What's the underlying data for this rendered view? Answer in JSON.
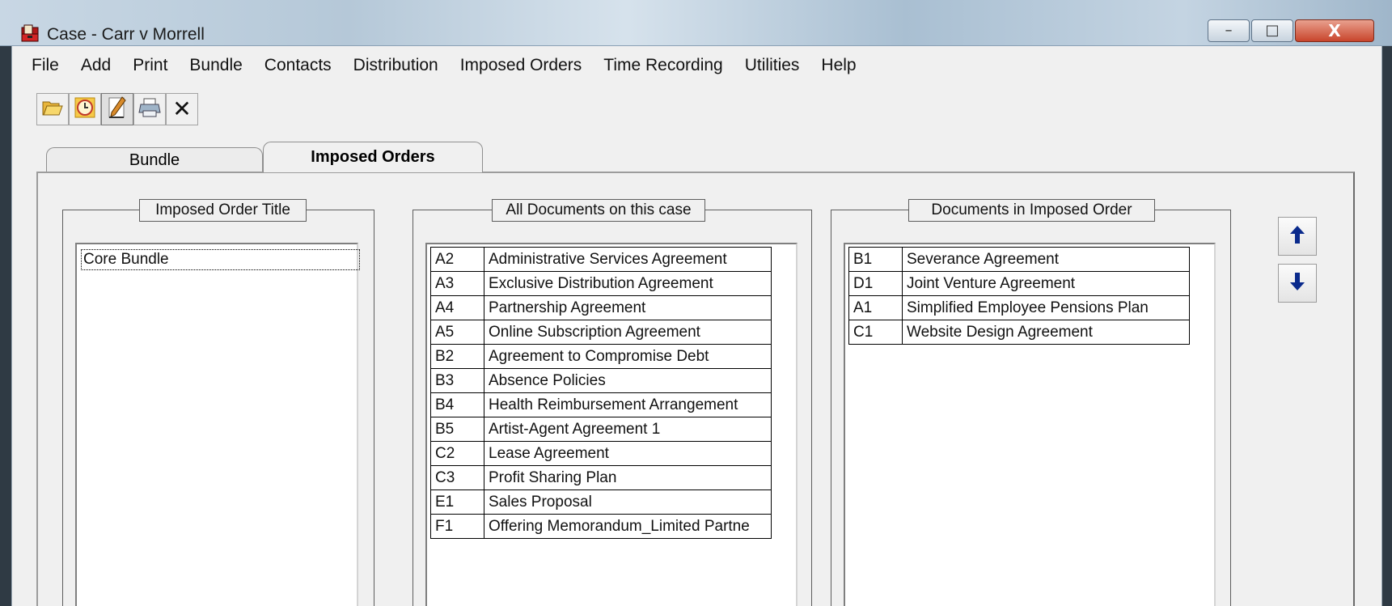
{
  "window": {
    "title": "Case - Carr v Morrell",
    "controls": {
      "minimize": "–",
      "maximize": "□",
      "close": "X"
    }
  },
  "menu": [
    "File",
    "Add",
    "Print",
    "Bundle",
    "Contacts",
    "Distribution",
    "Imposed Orders",
    "Time Recording",
    "Utilities",
    "Help"
  ],
  "toolbar": {
    "buttons": [
      "open-folder-icon",
      "clock-icon",
      "edit-pen-icon",
      "printer-icon",
      "close-x-icon"
    ],
    "close_glyph": "✕"
  },
  "tabs": {
    "bundle": "Bundle",
    "imposed_orders": "Imposed Orders",
    "active": "Imposed Orders"
  },
  "imposed_order_title": {
    "heading": "Imposed Order Title",
    "items": [
      "Core Bundle"
    ]
  },
  "all_documents": {
    "heading": "All Documents on this case",
    "rows": [
      {
        "code": "A2",
        "name": "Administrative Services Agreement"
      },
      {
        "code": "A3",
        "name": "Exclusive Distribution Agreement"
      },
      {
        "code": "A4",
        "name": "Partnership Agreement"
      },
      {
        "code": "A5",
        "name": "Online Subscription Agreement"
      },
      {
        "code": "B2",
        "name": "Agreement to Compromise Debt"
      },
      {
        "code": "B3",
        "name": "Absence Policies"
      },
      {
        "code": "B4",
        "name": "Health Reimbursement Arrangement"
      },
      {
        "code": "B5",
        "name": "Artist-Agent Agreement 1"
      },
      {
        "code": "C2",
        "name": "Lease Agreement"
      },
      {
        "code": "C3",
        "name": "Profit Sharing Plan"
      },
      {
        "code": "E1",
        "name": "Sales Proposal"
      },
      {
        "code": "F1",
        "name": "Offering Memorandum_Limited Partne"
      }
    ]
  },
  "imposed_documents": {
    "heading": "Documents in Imposed Order",
    "rows": [
      {
        "code": "B1",
        "name": "Severance Agreement"
      },
      {
        "code": "D1",
        "name": "Joint Venture Agreement"
      },
      {
        "code": "A1",
        "name": "Simplified Employee Pensions Plan"
      },
      {
        "code": "C1",
        "name": "Website Design Agreement"
      }
    ]
  },
  "order_controls": {
    "up": "move-up-arrow-icon",
    "down": "move-down-arrow-icon"
  },
  "colors": {
    "arrow": "#0a2a8c",
    "titlebar": "#b5c8d8",
    "close_button": "#c8452c"
  }
}
